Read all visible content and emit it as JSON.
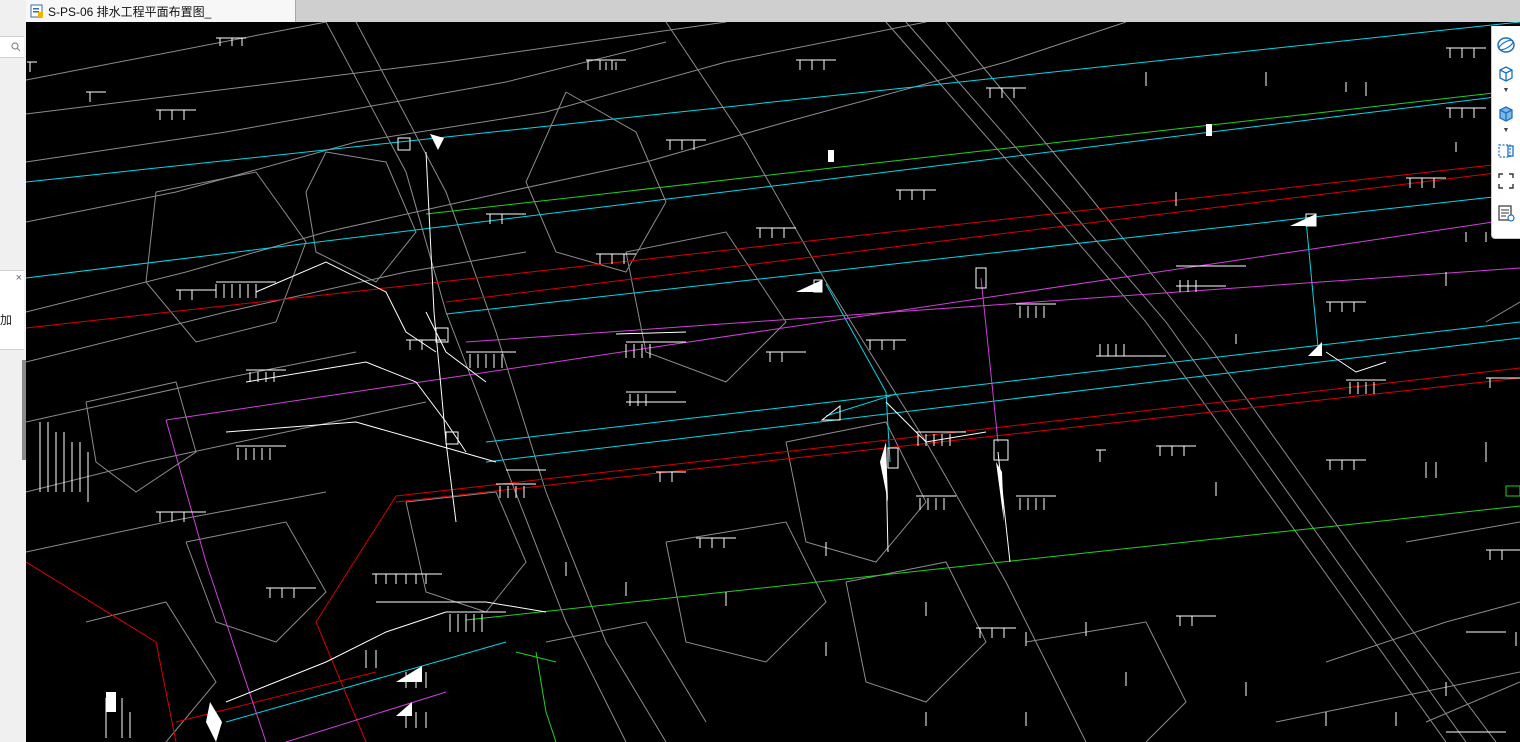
{
  "tab": {
    "title": "S-PS-06 排水工程平面布置图_",
    "icon": "dwg-file-icon"
  },
  "left_panel": {
    "search_icon": "search-icon",
    "close_glyph": "×",
    "add_label": "加"
  },
  "nav_toolbar": {
    "items": [
      {
        "name": "orbit-icon"
      },
      {
        "name": "view-cube-icon"
      },
      {
        "name": "visual-style-icon"
      },
      {
        "name": "pan-window-icon"
      },
      {
        "name": "zoom-extents-icon"
      },
      {
        "name": "layer-properties-icon"
      }
    ]
  },
  "colors": {
    "background": "#000000",
    "gray_line": "#8c8c8c",
    "cyan": "#00d8e8",
    "red": "#d80000",
    "magenta": "#d040d8",
    "green": "#20d020",
    "white": "#ffffff",
    "toolbar_blue": "#1a72c0"
  }
}
